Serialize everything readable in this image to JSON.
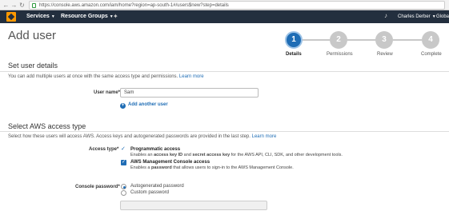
{
  "browser": {
    "url": "https://console.aws.amazon.com/iam/home?region=ap-south-1#/users$new?step=details"
  },
  "header": {
    "services_label": "Services",
    "resource_groups_label": "Resource Groups",
    "user_label": "Charles Derber",
    "region_label": "Global"
  },
  "page": {
    "title": "Add user"
  },
  "steps": [
    {
      "number": "1",
      "label": "Details"
    },
    {
      "number": "2",
      "label": "Permissions"
    },
    {
      "number": "3",
      "label": "Review"
    },
    {
      "number": "4",
      "label": "Complete"
    }
  ],
  "user_details": {
    "heading": "Set user details",
    "description": "You can add multiple users at once with the same access type and permissions.",
    "learn_more": "Learn more",
    "username_label": "User name*",
    "username_value": "Sam",
    "add_another_label": "Add another user"
  },
  "access_type": {
    "heading": "Select AWS access type",
    "description": "Select how these users will access AWS. Access keys and autogenerated passwords are provided in the last step.",
    "learn_more": "Learn more",
    "label": "Access type*",
    "programmatic_title": "Programmatic access",
    "programmatic_desc_1": "Enables an ",
    "programmatic_desc_access_key": "access key ID",
    "programmatic_desc_2": " and ",
    "programmatic_desc_secret": "secret access key",
    "programmatic_desc_3": " for the AWS API, CLI, SDK, and other development tools.",
    "console_title": "AWS Management Console access",
    "console_desc_1": "Enables a ",
    "console_desc_password": "password",
    "console_desc_2": " that allows users to sign-in to the AWS Management Console."
  },
  "console_password": {
    "label": "Console password*",
    "autogenerated_label": "Autogenerated password",
    "custom_label": "Custom password",
    "selected": "Autogenerated password"
  },
  "colors": {
    "accent": "#1f6db5",
    "header_bg": "#232f3e",
    "aws_orange": "#ff9900"
  }
}
